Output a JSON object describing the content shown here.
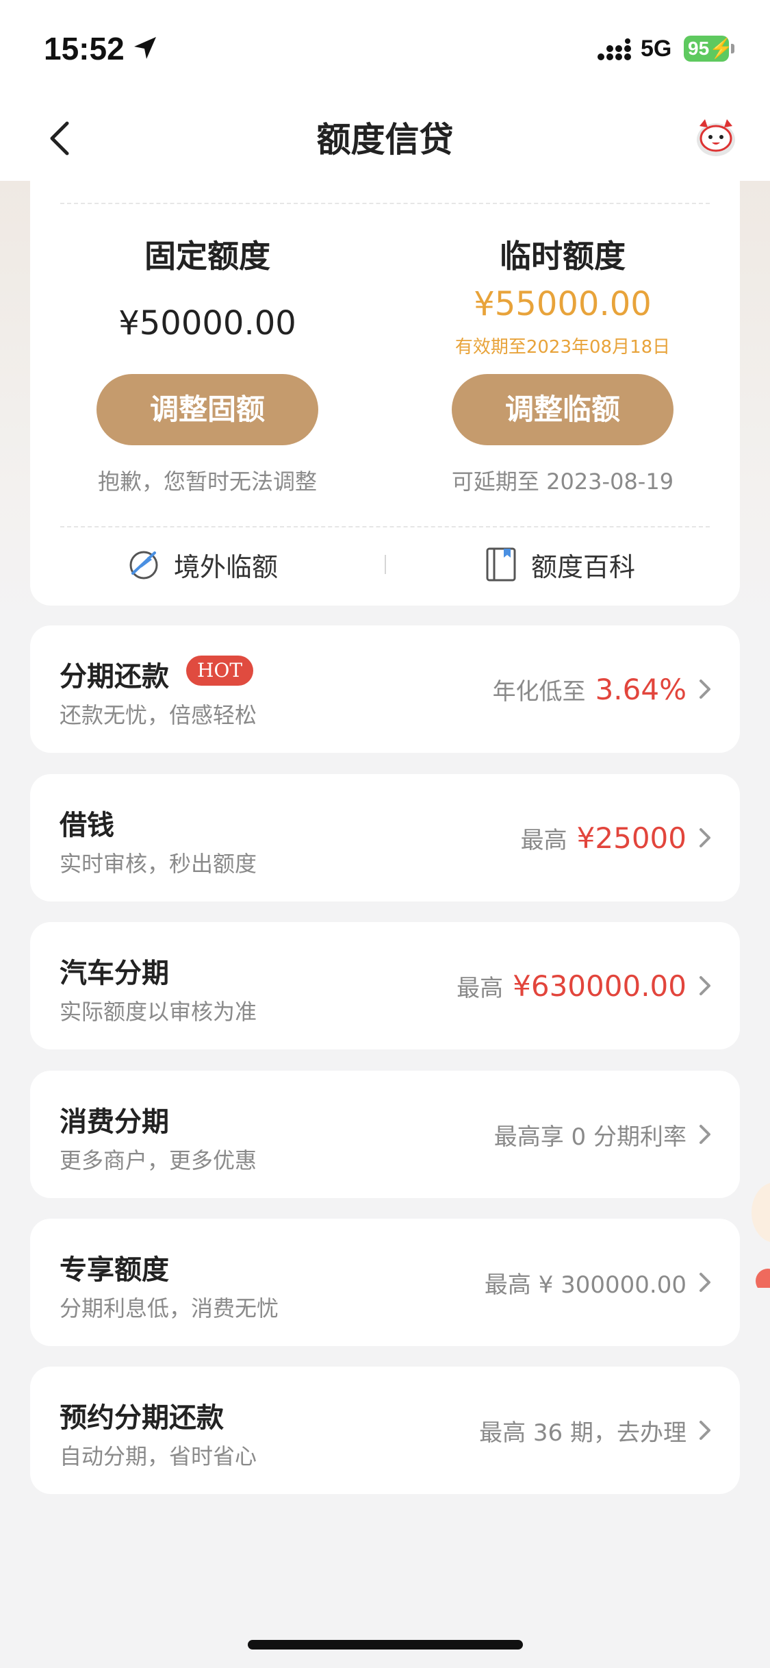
{
  "status_bar": {
    "time": "15:52",
    "network": "5G",
    "battery": "95"
  },
  "nav": {
    "title": "额度信贷",
    "back_icon": "chevron-left-icon",
    "mascot_icon": "mascot-icon"
  },
  "limits": {
    "fixed": {
      "title": "固定额度",
      "amount": "¥50000.00",
      "button": "调整固额",
      "note": "抱歉，您暂时无法调整"
    },
    "temporary": {
      "title": "临时额度",
      "amount": "¥55000.00",
      "valid": "有效期至2023年08月18日",
      "button": "调整临额",
      "note": "可延期至 2023-08-19"
    },
    "links": [
      {
        "label": "境外临额",
        "icon": "overseas-plane-icon"
      },
      {
        "label": "额度百科",
        "icon": "book-icon"
      }
    ]
  },
  "products": [
    {
      "title": "分期还款",
      "badge": "HOT",
      "subtitle": "还款无忧，倍感轻松",
      "right_label": "年化低至",
      "right_value": "3.64%"
    },
    {
      "title": "借钱",
      "subtitle": "实时审核，秒出额度",
      "right_label": "最高",
      "right_value": "¥25000"
    },
    {
      "title": "汽车分期",
      "subtitle": "实际额度以审核为准",
      "right_label": "最高",
      "right_value": "¥630000.00"
    },
    {
      "title": "消费分期",
      "subtitle": "更多商户，更多优惠",
      "right_text": "最高享 0 分期利率"
    },
    {
      "title": "专享额度",
      "subtitle": "分期利息低，消费无忧",
      "right_text": "最高 ¥ 300000.00"
    },
    {
      "title": "预约分期还款",
      "subtitle": "自动分期，省时省心",
      "right_text": "最高 36 期，去办理"
    }
  ],
  "colors": {
    "accent_gold": "#c59b6d",
    "temp_orange": "#e8a33a",
    "highlight_red": "#e2453c",
    "hot_red": "#e04b3f",
    "battery_green": "#5ec95f"
  }
}
